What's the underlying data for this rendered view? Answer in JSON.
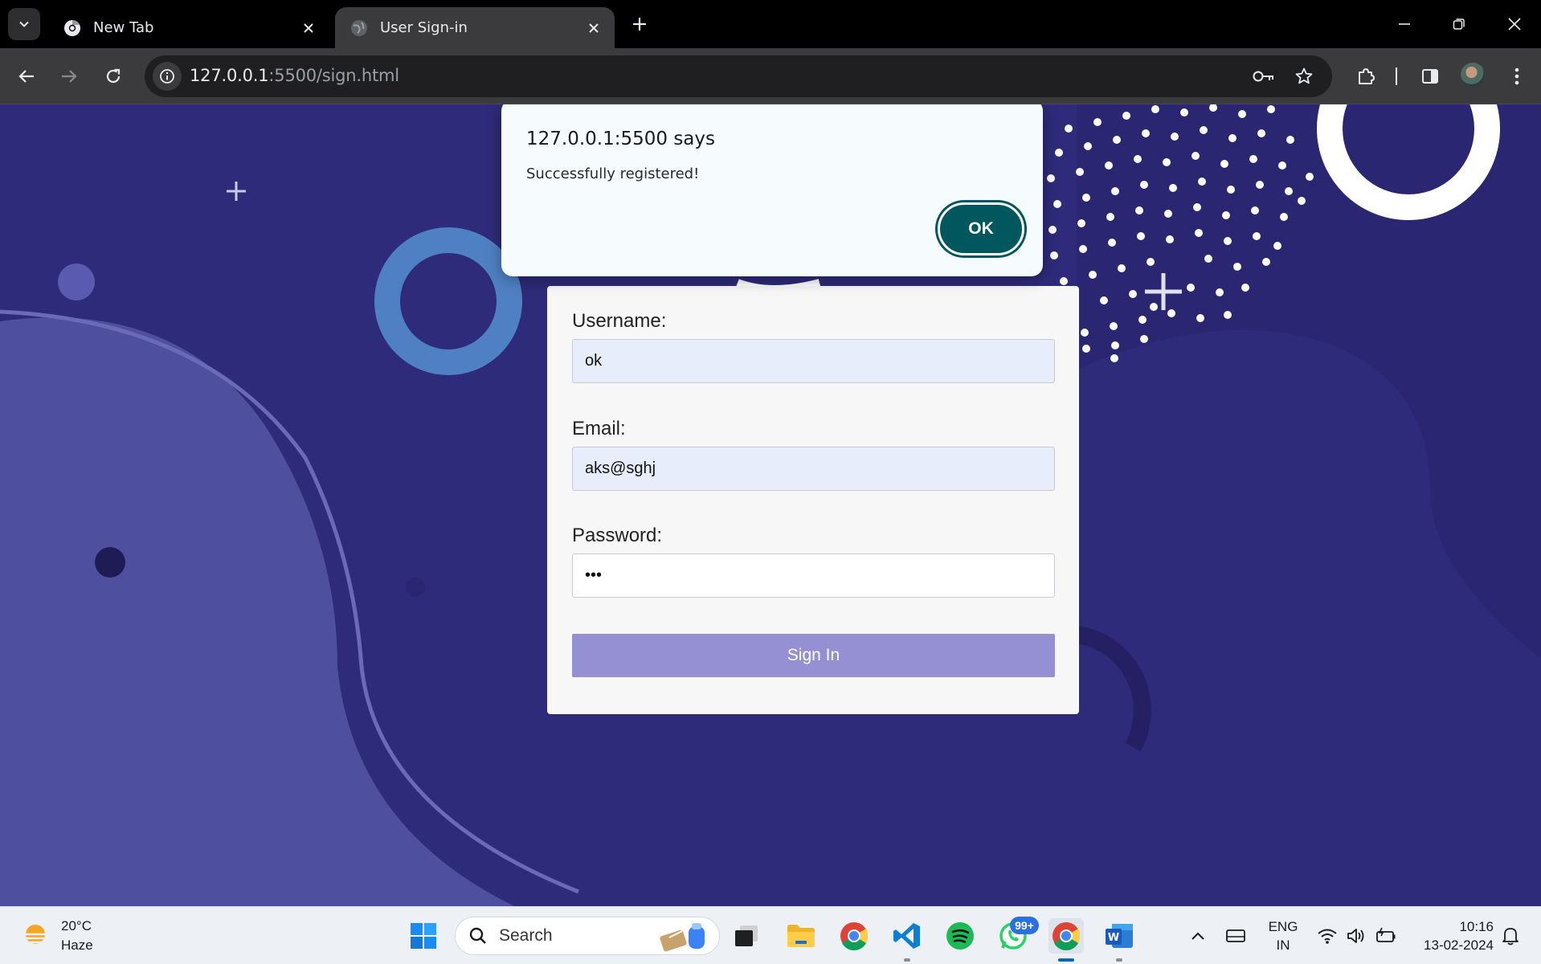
{
  "browser": {
    "tabs": [
      {
        "label": "New Tab",
        "icon": "chrome-icon"
      },
      {
        "label": "User Sign-in",
        "icon": "globe-icon",
        "active": true
      }
    ],
    "url_host": "127.0.0.1",
    "url_rest": ":5500/sign.html"
  },
  "dialog": {
    "title": "127.0.0.1:5500 says",
    "message": "Successfully registered!",
    "ok_label": "OK"
  },
  "form": {
    "username_label": "Username:",
    "username_value": "ok",
    "email_label": "Email:",
    "email_value": "aks@sghj",
    "password_label": "Password:",
    "password_value": "•••",
    "submit_label": "Sign In"
  },
  "taskbar": {
    "weather_temp": "20°C",
    "weather_desc": "Haze",
    "search_placeholder": "Search",
    "whatsapp_badge": "99+",
    "lang_top": "ENG",
    "lang_bottom": "IN",
    "time": "10:16",
    "date": "13-02-2024"
  },
  "colors": {
    "page_bg": "#2e2b7a",
    "wave": "#4f4fa0",
    "ring": "#4f80c4",
    "ok_button": "#00575e",
    "sign_in_button": "#958fd4"
  }
}
